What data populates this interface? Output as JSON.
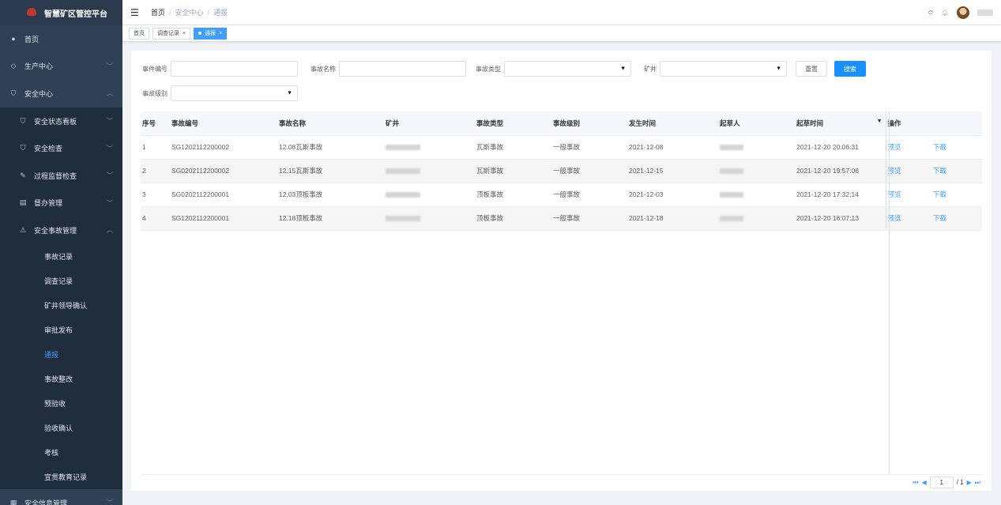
{
  "app": {
    "title": "智慧矿区管控平台"
  },
  "sidebar": {
    "items": [
      {
        "label": "首页",
        "icon": "dashboard-icon"
      },
      {
        "label": "生产中心",
        "icon": "layers-icon",
        "chevron": "﹀"
      },
      {
        "label": "安全中心",
        "icon": "shield-icon",
        "chevron": "︿"
      }
    ],
    "sub_items": [
      {
        "label": "安全状态看板",
        "icon": "shield-icon",
        "chevron": "﹀"
      },
      {
        "label": "安全检查",
        "icon": "shield-icon",
        "chevron": "﹀"
      },
      {
        "label": "过程监督检查",
        "icon": "edit-icon",
        "chevron": "﹀"
      },
      {
        "label": "督办管理",
        "icon": "document-icon",
        "chevron": "﹀"
      },
      {
        "label": "安全事故管理",
        "icon": "warning-icon",
        "chevron": "︿"
      }
    ],
    "leaves": [
      "事故记录",
      "调查记录",
      "矿井领导确认",
      "审批发布",
      "通报",
      "事故整改",
      "预验收",
      "验收确认",
      "考核",
      "宣贯教育记录"
    ],
    "bottom_item": {
      "label": "安全信息管理",
      "icon": "grid-icon",
      "chevron": "﹀"
    }
  },
  "header": {
    "breadcrumb": {
      "home": "首页",
      "sep": "/",
      "mid": "安全中心",
      "current": "通报"
    }
  },
  "tags": [
    {
      "label": "首页",
      "close": ""
    },
    {
      "label": "调查记录",
      "close": "×"
    },
    {
      "label": "通报",
      "close": "×",
      "active": true
    }
  ],
  "search": {
    "event_no_label": "事件编号",
    "event_name_label": "事故名称",
    "event_type_label": "事故类型",
    "mine_label": "矿井",
    "level_label": "事故级别",
    "reset_label": "重置",
    "search_label": "搜索"
  },
  "table": {
    "columns": [
      "序号",
      "事故编号",
      "事故名称",
      "矿井",
      "事故类型",
      "事故级别",
      "发生时间",
      "起草人",
      "起草时间",
      "操作"
    ],
    "rows": [
      {
        "idx": "1",
        "code": "SG1202112200002",
        "name": "12.08瓦斯事故",
        "type": "瓦斯事故",
        "level": "一般事故",
        "date": "2021-12-08",
        "drafted": "2021-12-20 20:06:31",
        "preview": "预览",
        "download": "下载"
      },
      {
        "idx": "2",
        "code": "SG0202112200002",
        "name": "12.15瓦斯事故",
        "type": "瓦斯事故",
        "level": "一般事故",
        "date": "2021-12-15",
        "drafted": "2021-12-20 19:57:06",
        "preview": "预览",
        "download": "下载"
      },
      {
        "idx": "3",
        "code": "SG0202112200001",
        "name": "12.03顶板事故",
        "type": "顶板事故",
        "level": "一般事故",
        "date": "2021-12-03",
        "drafted": "2021-12-20 17:32:14",
        "preview": "预览",
        "download": "下载"
      },
      {
        "idx": "4",
        "code": "SG1202112200001",
        "name": "12.18顶板事故",
        "type": "顶板事故",
        "level": "一般事故",
        "date": "2021-12-18",
        "drafted": "2021-12-20 16:07:13",
        "preview": "预览",
        "download": "下载"
      }
    ]
  },
  "pager": {
    "current": "1",
    "total": "/ 1"
  },
  "colors": {
    "sidebar_bg": "#304156",
    "accent": "#409eff",
    "search_btn": "#1890ff"
  }
}
